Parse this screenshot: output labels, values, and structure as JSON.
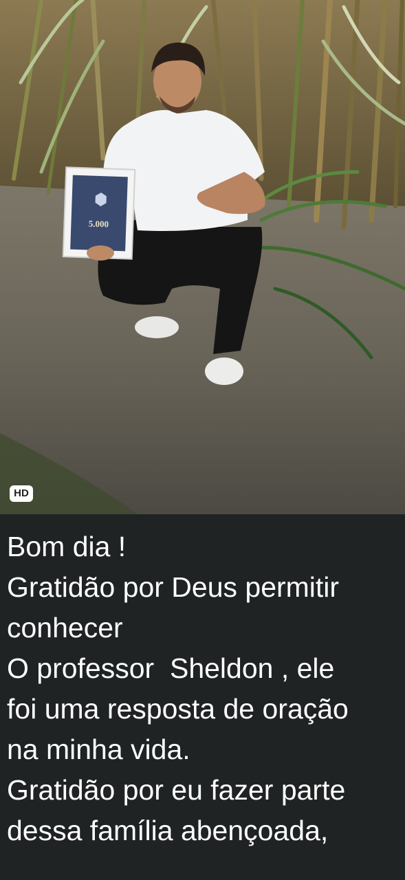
{
  "media": {
    "photo_alt": "Man crouching on a dirt path among sugarcane holding a framed plaque",
    "plaque": {
      "number": "5.000"
    },
    "badge": "HD"
  },
  "caption": {
    "lines": [
      "Bom dia !",
      "Gratidão por Deus permitir",
      "conhecer",
      "O professor  Sheldon , ele",
      "foi uma resposta de oração",
      "na minha vida.",
      "Gratidão por eu fazer parte",
      "dessa família abençoada,"
    ]
  },
  "colors": {
    "background": "#202324",
    "text": "#ffffff",
    "badge_bg": "#ffffff"
  }
}
